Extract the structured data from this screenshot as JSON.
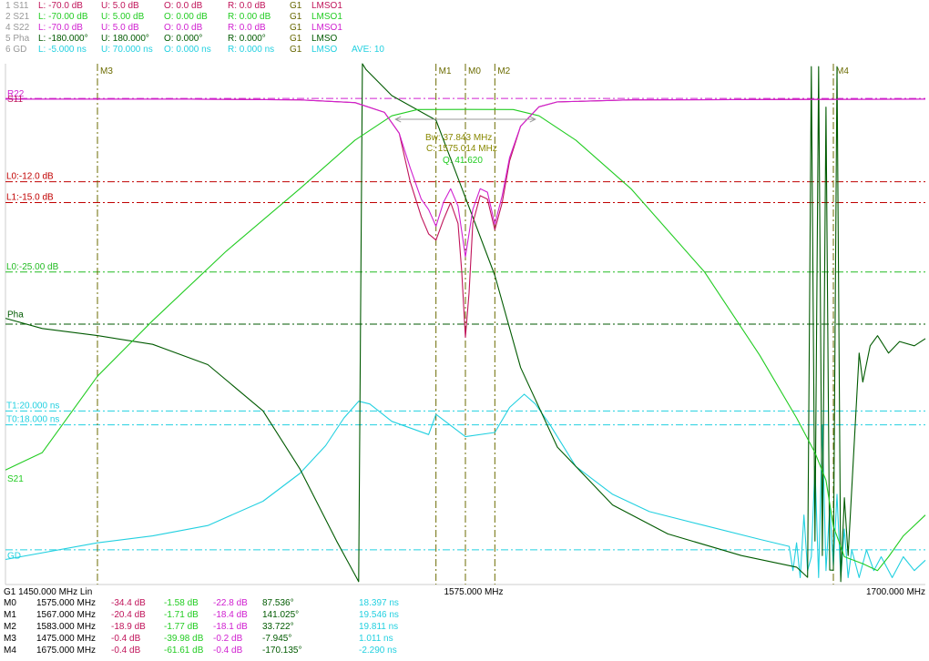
{
  "colors": {
    "s11": "#c0145a",
    "s21": "#22cc22",
    "s22": "#d020d0",
    "pha": "#005a00",
    "gd": "#22d0e0",
    "limit_red": "#c00000",
    "limit_green": "#22bb22",
    "cyan_line": "#22d0e0",
    "marker": "#6b6b00",
    "label_gray": "#999999",
    "text_green": "#008800",
    "text_black": "#000000"
  },
  "header": [
    {
      "id": "1 S11",
      "l": "L: -70.0 dB",
      "u": "U:  5.0 dB",
      "o": "O:  0.0 dB",
      "r": "R:  0.0 dB",
      "g": "G1",
      "m": "LMSO1",
      "ave": "",
      "color": "#c0145a"
    },
    {
      "id": "2 S21",
      "l": "L: -70.00 dB",
      "u": "U:  5.00 dB",
      "o": "O:  0.00 dB",
      "r": "R:  0.00 dB",
      "g": "G1",
      "m": "LMSO1",
      "ave": "",
      "color": "#22cc22"
    },
    {
      "id": "4 S22",
      "l": "L: -70.0 dB",
      "u": "U:  5.0 dB",
      "o": "O:  0.0 dB",
      "r": "R:  0.0 dB",
      "g": "G1",
      "m": "LMSO1",
      "ave": "",
      "color": "#d020d0"
    },
    {
      "id": "5 Pha",
      "l": "L: -180.000°",
      "u": "U: 180.000°",
      "o": "O:  0.000°",
      "r": "R:  0.000°",
      "g": "G1",
      "m": "LMSO",
      "ave": "",
      "color": "#005a00"
    },
    {
      "id": "6 GD",
      "l": "L: -5.000 ns",
      "u": "U: 70.000 ns",
      "o": "O:  0.000 ns",
      "r": "R:  0.000 ns",
      "g": "G1",
      "m": "LMSO",
      "ave": "AVE:  10",
      "color": "#22d0e0"
    }
  ],
  "chart_data": {
    "type": "line",
    "x_unit": "MHz",
    "xlim": [
      1450,
      1700
    ],
    "footer": {
      "start": "G1    1450.000 MHz  Lin",
      "center": "1575.000 MHz",
      "stop": "1700.000 MHz"
    },
    "traces": {
      "S11": {
        "label": "S11",
        "unit": "dB",
        "ylim": [
          -70,
          5
        ],
        "points": [
          [
            1450,
            -0.1
          ],
          [
            1500,
            -0.1
          ],
          [
            1530,
            -0.2
          ],
          [
            1545,
            -0.6
          ],
          [
            1553,
            -2
          ],
          [
            1557,
            -5
          ],
          [
            1560,
            -12
          ],
          [
            1563,
            -17
          ],
          [
            1565,
            -19.5
          ],
          [
            1567,
            -20.4
          ],
          [
            1569,
            -17.5
          ],
          [
            1571,
            -15
          ],
          [
            1573,
            -18
          ],
          [
            1574,
            -25
          ],
          [
            1575,
            -34.4
          ],
          [
            1576,
            -28
          ],
          [
            1577,
            -18
          ],
          [
            1579,
            -14
          ],
          [
            1581,
            -14.5
          ],
          [
            1583,
            -18.9
          ],
          [
            1585,
            -15
          ],
          [
            1587,
            -9
          ],
          [
            1590,
            -4
          ],
          [
            1595,
            -1.2
          ],
          [
            1600,
            -0.5
          ],
          [
            1620,
            -0.2
          ],
          [
            1700,
            -0.1
          ]
        ]
      },
      "S22": {
        "label": "S22",
        "unit": "dB",
        "ylim": [
          -70,
          5
        ],
        "points": [
          [
            1450,
            -0.1
          ],
          [
            1500,
            -0.1
          ],
          [
            1530,
            -0.2
          ],
          [
            1545,
            -0.6
          ],
          [
            1553,
            -2
          ],
          [
            1557,
            -5
          ],
          [
            1560,
            -10
          ],
          [
            1563,
            -14.5
          ],
          [
            1565,
            -16
          ],
          [
            1567,
            -18.4
          ],
          [
            1569,
            -15
          ],
          [
            1571,
            -13
          ],
          [
            1573,
            -15.5
          ],
          [
            1575,
            -22.8
          ],
          [
            1577,
            -16
          ],
          [
            1579,
            -13
          ],
          [
            1581,
            -13.5
          ],
          [
            1583,
            -18.1
          ],
          [
            1585,
            -14
          ],
          [
            1587,
            -8.5
          ],
          [
            1590,
            -4
          ],
          [
            1595,
            -1.2
          ],
          [
            1600,
            -0.5
          ],
          [
            1620,
            -0.2
          ],
          [
            1700,
            -0.1
          ]
        ]
      },
      "S21": {
        "label": "S21",
        "unit": "dB",
        "ylim": [
          -70,
          5
        ],
        "points": [
          [
            1450,
            -53.5
          ],
          [
            1460,
            -51
          ],
          [
            1475,
            -40
          ],
          [
            1490,
            -32
          ],
          [
            1510,
            -22
          ],
          [
            1530,
            -13
          ],
          [
            1545,
            -6
          ],
          [
            1555,
            -2.5
          ],
          [
            1562,
            -1.6
          ],
          [
            1575,
            -1.58
          ],
          [
            1588,
            -1.6
          ],
          [
            1595,
            -2.5
          ],
          [
            1605,
            -6
          ],
          [
            1620,
            -13
          ],
          [
            1640,
            -25
          ],
          [
            1655,
            -37
          ],
          [
            1665,
            -46
          ],
          [
            1670,
            -51
          ],
          [
            1673,
            -55
          ],
          [
            1675,
            -61.61
          ],
          [
            1678,
            -66
          ],
          [
            1683,
            -67
          ],
          [
            1687,
            -68
          ],
          [
            1690,
            -66
          ],
          [
            1694,
            -63
          ],
          [
            1700,
            -60
          ]
        ]
      },
      "Pha": {
        "label": "Pha",
        "unit": "°",
        "ylim": [
          -180,
          180
        ],
        "points": [
          [
            1450,
            4
          ],
          [
            1460,
            -3
          ],
          [
            1475,
            -7.9
          ],
          [
            1490,
            -14
          ],
          [
            1505,
            -28
          ],
          [
            1520,
            -60
          ],
          [
            1530,
            -100
          ],
          [
            1540,
            -150
          ],
          [
            1546,
            -178
          ],
          [
            1547,
            180
          ],
          [
            1548,
            176
          ],
          [
            1555,
            158
          ],
          [
            1567,
            141
          ],
          [
            1575,
            87.5
          ],
          [
            1583,
            33.7
          ],
          [
            1590,
            -30
          ],
          [
            1600,
            -85
          ],
          [
            1615,
            -125
          ],
          [
            1630,
            -145
          ],
          [
            1650,
            -160
          ],
          [
            1665,
            -168
          ],
          [
            1668,
            -175
          ],
          [
            1669,
            178
          ],
          [
            1670,
            -150
          ],
          [
            1671,
            178
          ],
          [
            1672,
            -160
          ],
          [
            1673,
            150
          ],
          [
            1674,
            -170
          ],
          [
            1675,
            -170.1
          ],
          [
            1676,
            178
          ],
          [
            1677,
            -178
          ],
          [
            1678,
            -120
          ],
          [
            1679,
            -160
          ],
          [
            1682,
            -20
          ],
          [
            1683,
            -40
          ],
          [
            1685,
            -15
          ],
          [
            1687,
            -8
          ],
          [
            1690,
            -20
          ],
          [
            1693,
            -12
          ],
          [
            1697,
            -15
          ],
          [
            1700,
            -10
          ]
        ]
      },
      "GD": {
        "label": "GD",
        "unit": "ns",
        "ylim": [
          -5,
          70
        ],
        "points": [
          [
            1450,
            -1.4
          ],
          [
            1475,
            1.0
          ],
          [
            1490,
            2.0
          ],
          [
            1505,
            3.5
          ],
          [
            1520,
            7
          ],
          [
            1530,
            11
          ],
          [
            1537,
            15
          ],
          [
            1542,
            19
          ],
          [
            1546,
            21.4
          ],
          [
            1549,
            21
          ],
          [
            1555,
            18.5
          ],
          [
            1565,
            16.6
          ],
          [
            1567,
            19.5
          ],
          [
            1575,
            16.3
          ],
          [
            1583,
            16.9
          ],
          [
            1587,
            20.5
          ],
          [
            1591,
            22.4
          ],
          [
            1594,
            21
          ],
          [
            1598,
            18
          ],
          [
            1605,
            12
          ],
          [
            1615,
            8
          ],
          [
            1625,
            5.5
          ],
          [
            1640,
            3.5
          ],
          [
            1655,
            1.5
          ],
          [
            1663,
            0.5
          ],
          [
            1664,
            -3
          ],
          [
            1665,
            1
          ],
          [
            1666,
            -4
          ],
          [
            1667,
            5
          ],
          [
            1668,
            -3
          ],
          [
            1669,
            -1
          ],
          [
            1670,
            12
          ],
          [
            1671,
            -4
          ],
          [
            1672,
            18
          ],
          [
            1673,
            -3
          ],
          [
            1674,
            6
          ],
          [
            1675,
            -2.29
          ],
          [
            1676,
            8
          ],
          [
            1677,
            -4
          ],
          [
            1678,
            3
          ],
          [
            1679,
            -4
          ],
          [
            1680,
            0
          ],
          [
            1682,
            -4
          ],
          [
            1684,
            0
          ],
          [
            1686,
            -3
          ],
          [
            1688,
            -1
          ],
          [
            1691,
            -4
          ],
          [
            1694,
            -1
          ],
          [
            1697,
            -3
          ],
          [
            1700,
            -1.5
          ]
        ]
      }
    },
    "limit_lines": [
      {
        "label": "L0:-12.0 dB",
        "value": -12,
        "scale": "dB",
        "color": "#c00000"
      },
      {
        "label": "L1:-15.0 dB",
        "value": -15,
        "scale": "dB",
        "color": "#c00000"
      },
      {
        "label": "L0:-25.00 dB",
        "value": -25,
        "scale": "dB",
        "color": "#22bb22"
      },
      {
        "label": "T1:20.000 ns",
        "value": 20,
        "scale": "ns",
        "color": "#22d0e0"
      },
      {
        "label": "T0:18.000 ns",
        "value": 18,
        "scale": "ns",
        "color": "#22d0e0"
      }
    ],
    "trace_labels": [
      {
        "text": "R22",
        "trace": "S22",
        "color": "#d020d0"
      },
      {
        "text": "S11",
        "trace": "S11",
        "color": "#c0145a"
      },
      {
        "text": "S21",
        "trace": "S21",
        "color": "#22cc22"
      },
      {
        "text": "Pha",
        "trace": "Pha",
        "color": "#005a00"
      },
      {
        "text": "GD",
        "trace": "GD",
        "color": "#22d0e0"
      }
    ],
    "markers": [
      {
        "name": "M3",
        "freq": 1475
      },
      {
        "name": "M1",
        "freq": 1567
      },
      {
        "name": "M0",
        "freq": 1575
      },
      {
        "name": "M2",
        "freq": 1583
      },
      {
        "name": "M4",
        "freq": 1675
      }
    ],
    "bw": {
      "bw": "Bw:  37.843 MHz",
      "center": "C: 1575.014 MHz",
      "q": "Q:  41.620",
      "f_low": 1556,
      "f_high": 1594,
      "level": -3
    },
    "marker_table": [
      {
        "m": "M0",
        "f": "1575.000 MHz",
        "s11": "-34.4 dB",
        "s21": "-1.58 dB",
        "s22": "-22.8 dB",
        "pha": "87.536°",
        "gd": "18.397 ns"
      },
      {
        "m": "M1",
        "f": "1567.000 MHz",
        "s11": "-20.4 dB",
        "s21": "-1.71 dB",
        "s22": "-18.4 dB",
        "pha": "141.025°",
        "gd": "19.546 ns"
      },
      {
        "m": "M2",
        "f": "1583.000 MHz",
        "s11": "-18.9 dB",
        "s21": "-1.77 dB",
        "s22": "-18.1 dB",
        "pha": "33.722°",
        "gd": "19.811 ns"
      },
      {
        "m": "M3",
        "f": "1475.000 MHz",
        "s11": "-0.4 dB",
        "s21": "-39.98 dB",
        "s22": "-0.2 dB",
        "pha": "-7.945°",
        "gd": "1.011 ns"
      },
      {
        "m": "M4",
        "f": "1675.000 MHz",
        "s11": "-0.4 dB",
        "s21": "-61.61 dB",
        "s22": "-0.4 dB",
        "pha": "-170.135°",
        "gd": "-2.290 ns"
      }
    ]
  }
}
